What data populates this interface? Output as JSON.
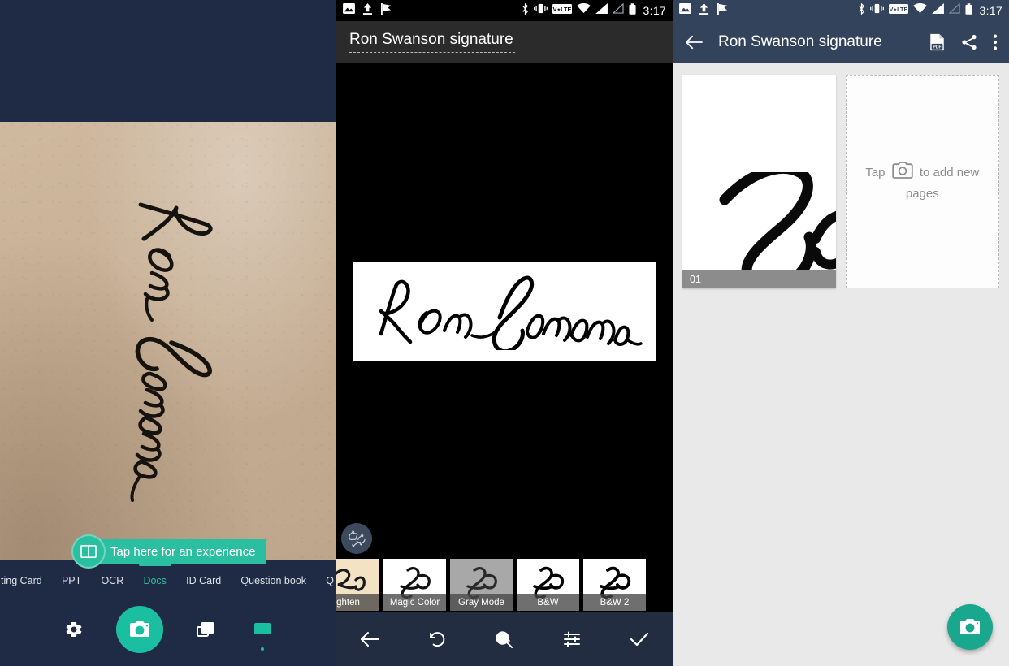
{
  "status_bar": {
    "time": "3:17",
    "left_icons": [
      "image-icon",
      "upload-icon",
      "flag-icon"
    ],
    "right_icons": [
      "bluetooth-icon",
      "vibrate-icon",
      "volte-icon",
      "wifi-icon",
      "signal-icon",
      "signal-off-icon",
      "battery-icon"
    ]
  },
  "panel1_camera": {
    "banner": {
      "label": "Tap here for an experience",
      "icon": "book-icon"
    },
    "tabs": [
      {
        "label": "ting Card",
        "active": false
      },
      {
        "label": "PPT",
        "active": false
      },
      {
        "label": "OCR",
        "active": false
      },
      {
        "label": "Docs",
        "active": true
      },
      {
        "label": "ID Card",
        "active": false
      },
      {
        "label": "Question book",
        "active": false
      },
      {
        "label": "Q",
        "active": false
      }
    ],
    "nav": [
      {
        "name": "settings",
        "icon": "gear-icon"
      },
      {
        "name": "shutter",
        "icon": "camera-icon"
      },
      {
        "name": "gallery",
        "icon": "layers-icon"
      },
      {
        "name": "batch",
        "icon": "rectangle-icon"
      }
    ],
    "accent_color": "#29bfa0",
    "chrome_color": "#1f2b44"
  },
  "panel2_editor": {
    "title": "Ron Swanson signature",
    "filters": [
      {
        "label": "ghten",
        "selected": false,
        "bg": "#f2e2c2"
      },
      {
        "label": "Magic Color",
        "selected": false,
        "bg": "#ffffff"
      },
      {
        "label": "Gray Mode",
        "selected": false,
        "bg": "#a6a6a6"
      },
      {
        "label": "B&W",
        "selected": false,
        "bg": "#ffffff"
      },
      {
        "label": "B&W 2",
        "selected": true,
        "bg": "#ffffff"
      }
    ],
    "feedback_button": "thumbs-feedback-icon",
    "toolbar": [
      {
        "name": "back",
        "icon": "arrow-left-icon"
      },
      {
        "name": "rotate",
        "icon": "rotate-left-icon"
      },
      {
        "name": "ocr",
        "icon": "ocr-search-icon"
      },
      {
        "name": "adjust",
        "icon": "sliders-icon"
      },
      {
        "name": "confirm",
        "icon": "check-icon"
      }
    ],
    "selected_color": "#29bfa0"
  },
  "panel3_pages": {
    "title": "Ron Swanson signature",
    "back_icon": "arrow-left-icon",
    "actions": [
      {
        "name": "export-pdf",
        "icon": "pdf-icon"
      },
      {
        "name": "share",
        "icon": "share-icon"
      },
      {
        "name": "overflow-menu",
        "icon": "more-vertical-icon"
      }
    ],
    "pages": [
      {
        "number": "01"
      }
    ],
    "add_page": {
      "prefix": "Tap",
      "icon": "camera-icon",
      "suffix": "to add new pages"
    },
    "fab": {
      "icon": "camera-icon",
      "color": "#19a88e"
    },
    "background": "#e9e9e9",
    "appbar_color": "#33435c"
  }
}
